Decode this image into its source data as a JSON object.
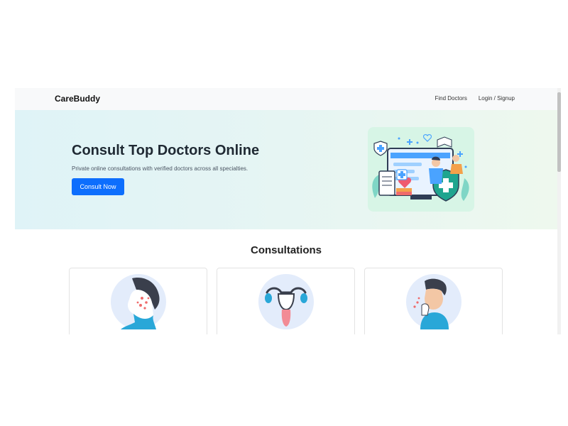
{
  "navbar": {
    "brand": "CareBuddy",
    "links": [
      "Find Doctors",
      "Login / Signup"
    ]
  },
  "hero": {
    "title": "Consult Top Doctors Online",
    "subtitle": "Private online consultations with verified doctors across all specialties.",
    "button_label": "Consult Now",
    "illustration_icon": "telemedicine-illustration"
  },
  "consultations": {
    "title": "Consultations",
    "cards": [
      {
        "icon": "skin-acne-icon"
      },
      {
        "icon": "uterus-icon"
      },
      {
        "icon": "cough-icon"
      }
    ]
  },
  "colors": {
    "accent": "#0d6efd",
    "hero_bg_start": "#dff3f7",
    "hero_bg_end": "#eef8ee",
    "navbar_bg": "#f8f9fa"
  }
}
